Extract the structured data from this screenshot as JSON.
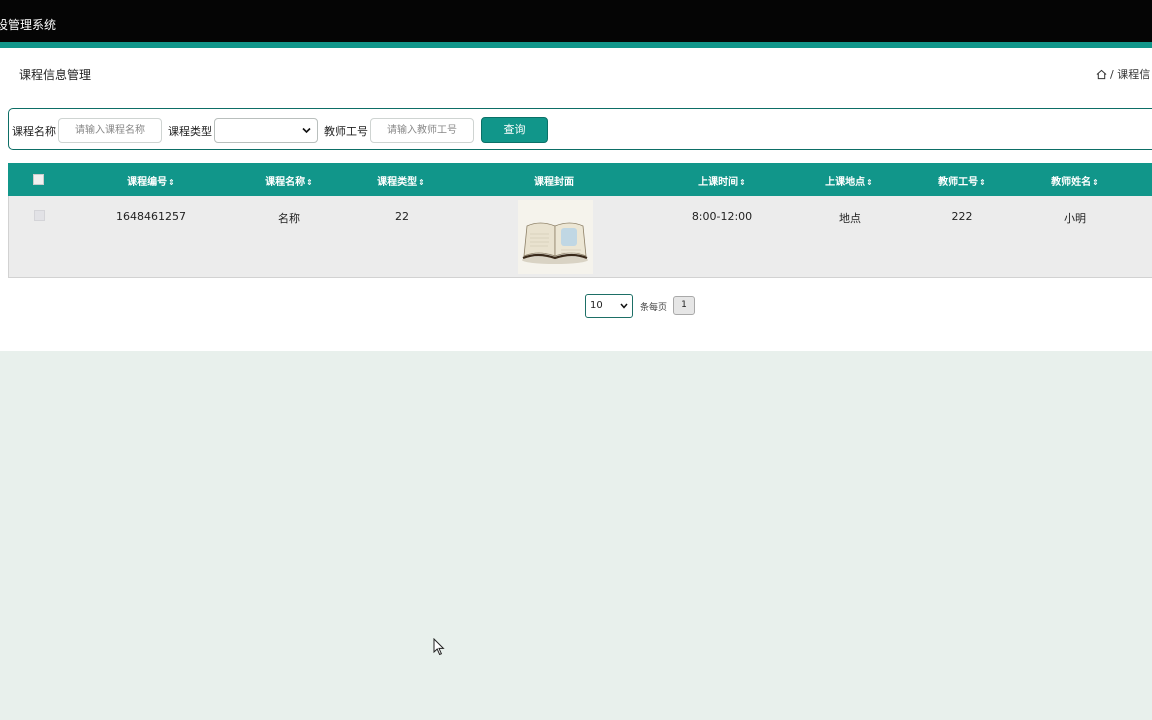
{
  "app": {
    "title": "设管理系统"
  },
  "page": {
    "title": "课程信息管理",
    "breadcrumb": "/ 课程信"
  },
  "search": {
    "course_name_label": "课程名称",
    "course_name_placeholder": "请输入课程名称",
    "course_type_label": "课程类型",
    "course_type_value": "",
    "teacher_id_label": "教师工号",
    "teacher_id_placeholder": "请输入教师工号",
    "query_label": "查询"
  },
  "table": {
    "sort_glyph": "⇕",
    "headers": [
      "课程编号",
      "课程名称",
      "课程类型",
      "课程封面",
      "上课时间",
      "上课地点",
      "教师工号",
      "教师姓名"
    ],
    "rows": [
      {
        "course_id": "1648461257",
        "course_name": "名称",
        "course_type": "22",
        "cover": "open-book-image",
        "class_time": "8:00-12:00",
        "location": "地点",
        "teacher_id": "222",
        "teacher_name": "小明"
      }
    ]
  },
  "pagination": {
    "page_size": "10",
    "per_page_label": "条每页",
    "current_page": "1"
  },
  "colors": {
    "accent": "#11968a",
    "topbar": "#050505",
    "background": "#e8f0ec"
  }
}
